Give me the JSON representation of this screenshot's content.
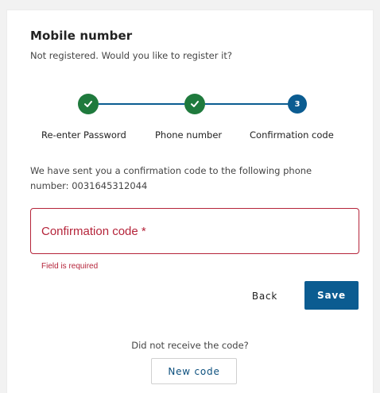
{
  "header": {
    "title": "Mobile number",
    "subtitle": "Not registered. Would you like to register it?"
  },
  "stepper": {
    "steps": [
      {
        "label": "Re-enter Password",
        "state": "completed",
        "icon": "check-icon"
      },
      {
        "label": "Phone number",
        "state": "completed",
        "icon": "check-icon"
      },
      {
        "label": "Confirmation code",
        "state": "current",
        "number": "3"
      }
    ]
  },
  "info": {
    "text": "We have sent you a confirmation code to the following phone number: 0031645312044"
  },
  "form": {
    "confirmation_placeholder": "Confirmation code *",
    "error_message": "Field is required"
  },
  "actions": {
    "back_label": "Back",
    "save_label": "Save"
  },
  "resend": {
    "prompt": "Did not receive the code?",
    "new_code_label": "New code"
  },
  "colors": {
    "primary": "#0b5c91",
    "success": "#1f7a3d",
    "error": "#b5243a"
  }
}
